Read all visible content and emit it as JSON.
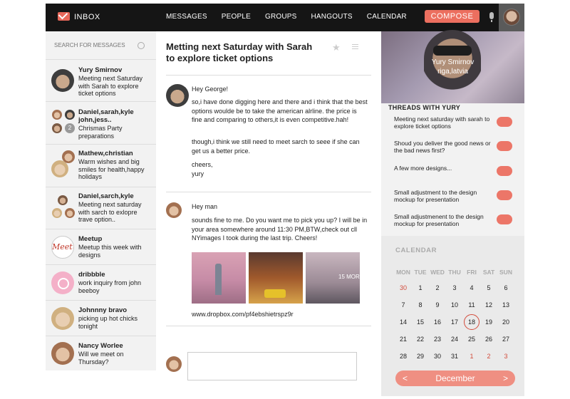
{
  "topbar": {
    "title": "INBOX",
    "nav": [
      "MESSAGES",
      "PEOPLE",
      "GROUPS",
      "HANGOUTS",
      "CALENDAR"
    ],
    "compose_label": "COMPOSE"
  },
  "search": {
    "placeholder": "SEARCH FOR MESSAGES"
  },
  "messages": [
    {
      "name": "Yury Smirnov",
      "snippet": "Meeting next Saturday with Sarah to explore ticket options"
    },
    {
      "name": "Daniel,sarah,kyle john,jess..",
      "snippet": "Chrismas Party preparations",
      "count": "2"
    },
    {
      "name": "Mathew,christian",
      "snippet": "Warm wishes and big smiles for health,happy holidays"
    },
    {
      "name": "Daniel,sarch,kyle",
      "snippet": "Meeting next saturday with sarch to exlopre trave option.."
    },
    {
      "name": "Meetup",
      "snippet": "Meetup this week with designs",
      "logo": "Meetup"
    },
    {
      "name": "dribbble",
      "snippet": "work inquiry from john beeboy"
    },
    {
      "name": "Johnnny bravo",
      "snippet": "picking up hot chicks tonight"
    },
    {
      "name": "Nancy Worlee",
      "snippet": "Will we meet on Thursday?"
    }
  ],
  "conversation": {
    "subject": "Metting next Saturday with Sarah to explore ticket options",
    "msg1": {
      "greeting": "Hey George!",
      "p1": "so,i have done digging here and there and i think that the best options woulde be to take the american alrline. the price is fine and comparing to others,it is even competitive.hah!",
      "p2": "though,i think we still need to meet sarch to seee if she can get us a better price.",
      "p3": "cheers,",
      "p4": "yury"
    },
    "msg2": {
      "greeting": "Hey man",
      "p1": "sounds fine to me. Do you want me to pick you up? I will be in your area somewhere around 11:30 PM,BTW,check out cll NYimages I took during the last trip. Cheers!",
      "photo_caption": "15 MOR",
      "link": "www.dropbox.com/pf4ebshietrspz9r"
    }
  },
  "profile": {
    "name": "Yury Smirnov",
    "location": "riga,latvia"
  },
  "threads": {
    "title": "THREADS WITH YURY",
    "items": [
      "Meeting next saturday with sarah to explore ticket options",
      "Shoud you deliver the good news or the bad news first?",
      "A few more designs...",
      "Small adjustment to the design mockup for presentation",
      "Small adjustmenent to the design mockup for presentation"
    ]
  },
  "calendar": {
    "title": "CALENDAR",
    "dow": [
      "MON",
      "TUE",
      "WED",
      "THU",
      "FRI",
      "SAT",
      "SUN"
    ],
    "weeks": [
      [
        "30",
        "1",
        "2",
        "3",
        "4",
        "5",
        "6"
      ],
      [
        "7",
        "8",
        "9",
        "10",
        "11",
        "12",
        "13"
      ],
      [
        "14",
        "15",
        "16",
        "17",
        "18",
        "19",
        "20"
      ],
      [
        "21",
        "22",
        "23",
        "24",
        "25",
        "26",
        "27"
      ],
      [
        "28",
        "29",
        "30",
        "31",
        "1",
        "2",
        "3"
      ]
    ],
    "today": "18",
    "month": "December",
    "prev": "<",
    "next": ">"
  },
  "colors": {
    "accent": "#ec6f5f",
    "topbar": "#151515",
    "panel": "#f2f2f2"
  }
}
